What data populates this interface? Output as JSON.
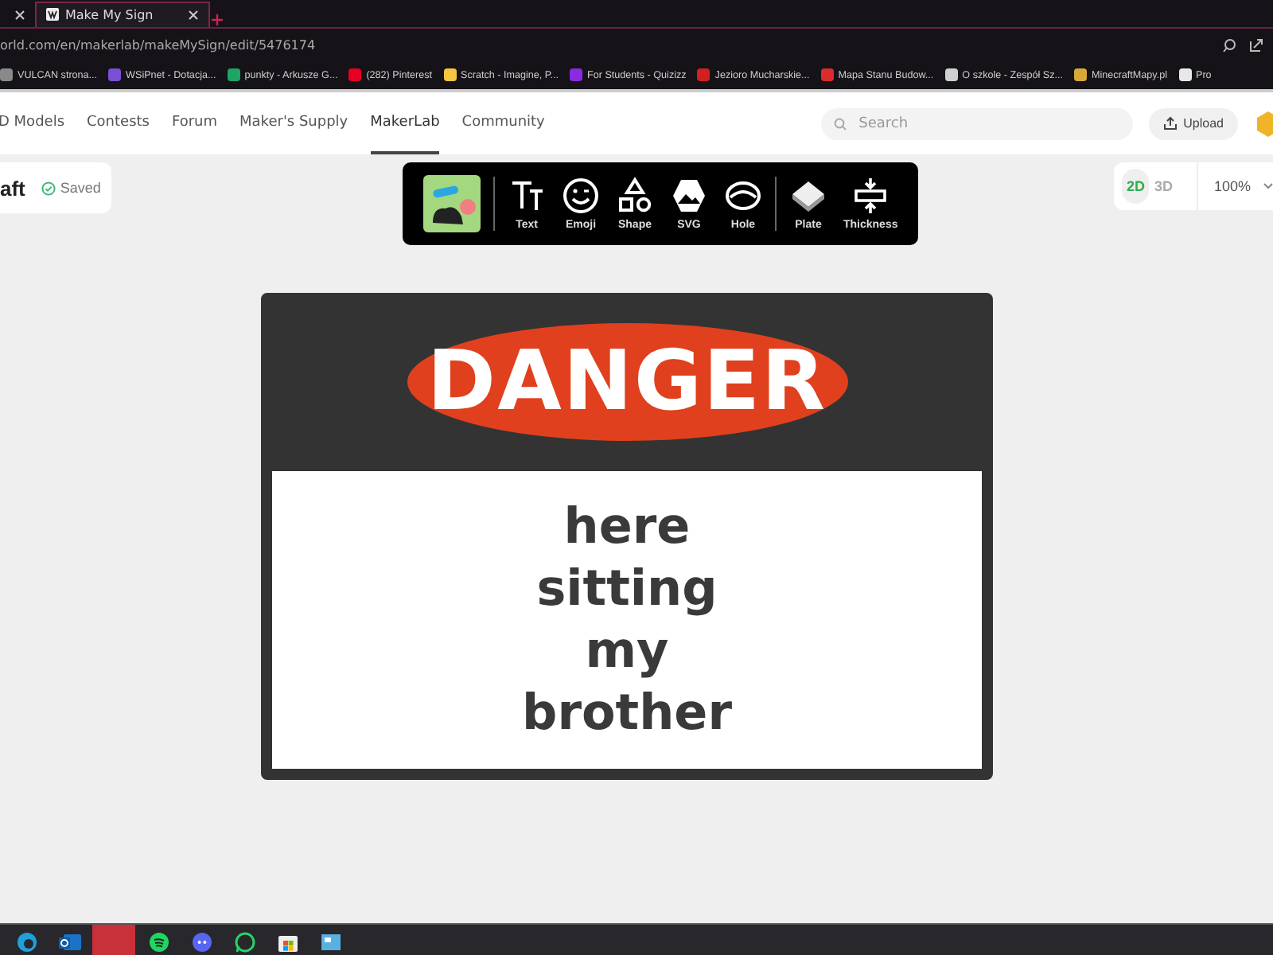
{
  "browser": {
    "tabs": [
      {
        "selected": false
      },
      {
        "title": "Make My Sign",
        "selected": true
      }
    ],
    "address": "orld.com/en/makerlab/makeMySign/edit/5476174",
    "bookmarks": [
      {
        "label": "VULCAN strona...",
        "color": "#8a8a8a"
      },
      {
        "label": "WSiPnet - Dotacja...",
        "color": "#7b4fd6"
      },
      {
        "label": "punkty - Arkusze G...",
        "color": "#1fa463"
      },
      {
        "label": "(282) Pinterest",
        "color": "#e60023"
      },
      {
        "label": "Scratch - Imagine, P...",
        "color": "#f5c542"
      },
      {
        "label": "For Students - Quizizz",
        "color": "#8a2be2"
      },
      {
        "label": "Jezioro Mucharskie...",
        "color": "#d22020"
      },
      {
        "label": "Mapa Stanu Budow...",
        "color": "#dc2b2b"
      },
      {
        "label": "O szkole - Zespół Sz...",
        "color": "#cfcfcf"
      },
      {
        "label": "MinecraftMapy.pl",
        "color": "#d8a93a"
      },
      {
        "label": "Pro",
        "color": "#e8e8e8"
      }
    ]
  },
  "site_nav": {
    "items": [
      {
        "label": "D Models",
        "selected": false
      },
      {
        "label": "Contests",
        "selected": false
      },
      {
        "label": "Forum",
        "selected": false
      },
      {
        "label": "Maker's Supply",
        "selected": false
      },
      {
        "label": "MakerLab",
        "selected": true
      },
      {
        "label": "Community",
        "selected": false
      }
    ],
    "search": {
      "placeholder": "Search"
    },
    "upload": "Upload"
  },
  "editor": {
    "title": "aft",
    "status": "Saved",
    "tools": [
      {
        "kind": "picture"
      },
      {
        "kind": "text",
        "label": "Text"
      },
      {
        "kind": "emoji",
        "label": "Emoji"
      },
      {
        "kind": "shape",
        "label": "Shape"
      },
      {
        "kind": "svg",
        "label": "SVG"
      },
      {
        "kind": "hole",
        "label": "Hole"
      },
      {
        "kind": "plate",
        "label": "Plate"
      },
      {
        "kind": "thickness",
        "label": "Thickness"
      }
    ],
    "views": [
      {
        "label": "2D",
        "selected": true
      },
      {
        "label": "3D",
        "selected": false
      }
    ],
    "zoom": "100%",
    "sign": {
      "header": "DANGER",
      "body": "here\nsitting\nmy\nbrother"
    }
  }
}
